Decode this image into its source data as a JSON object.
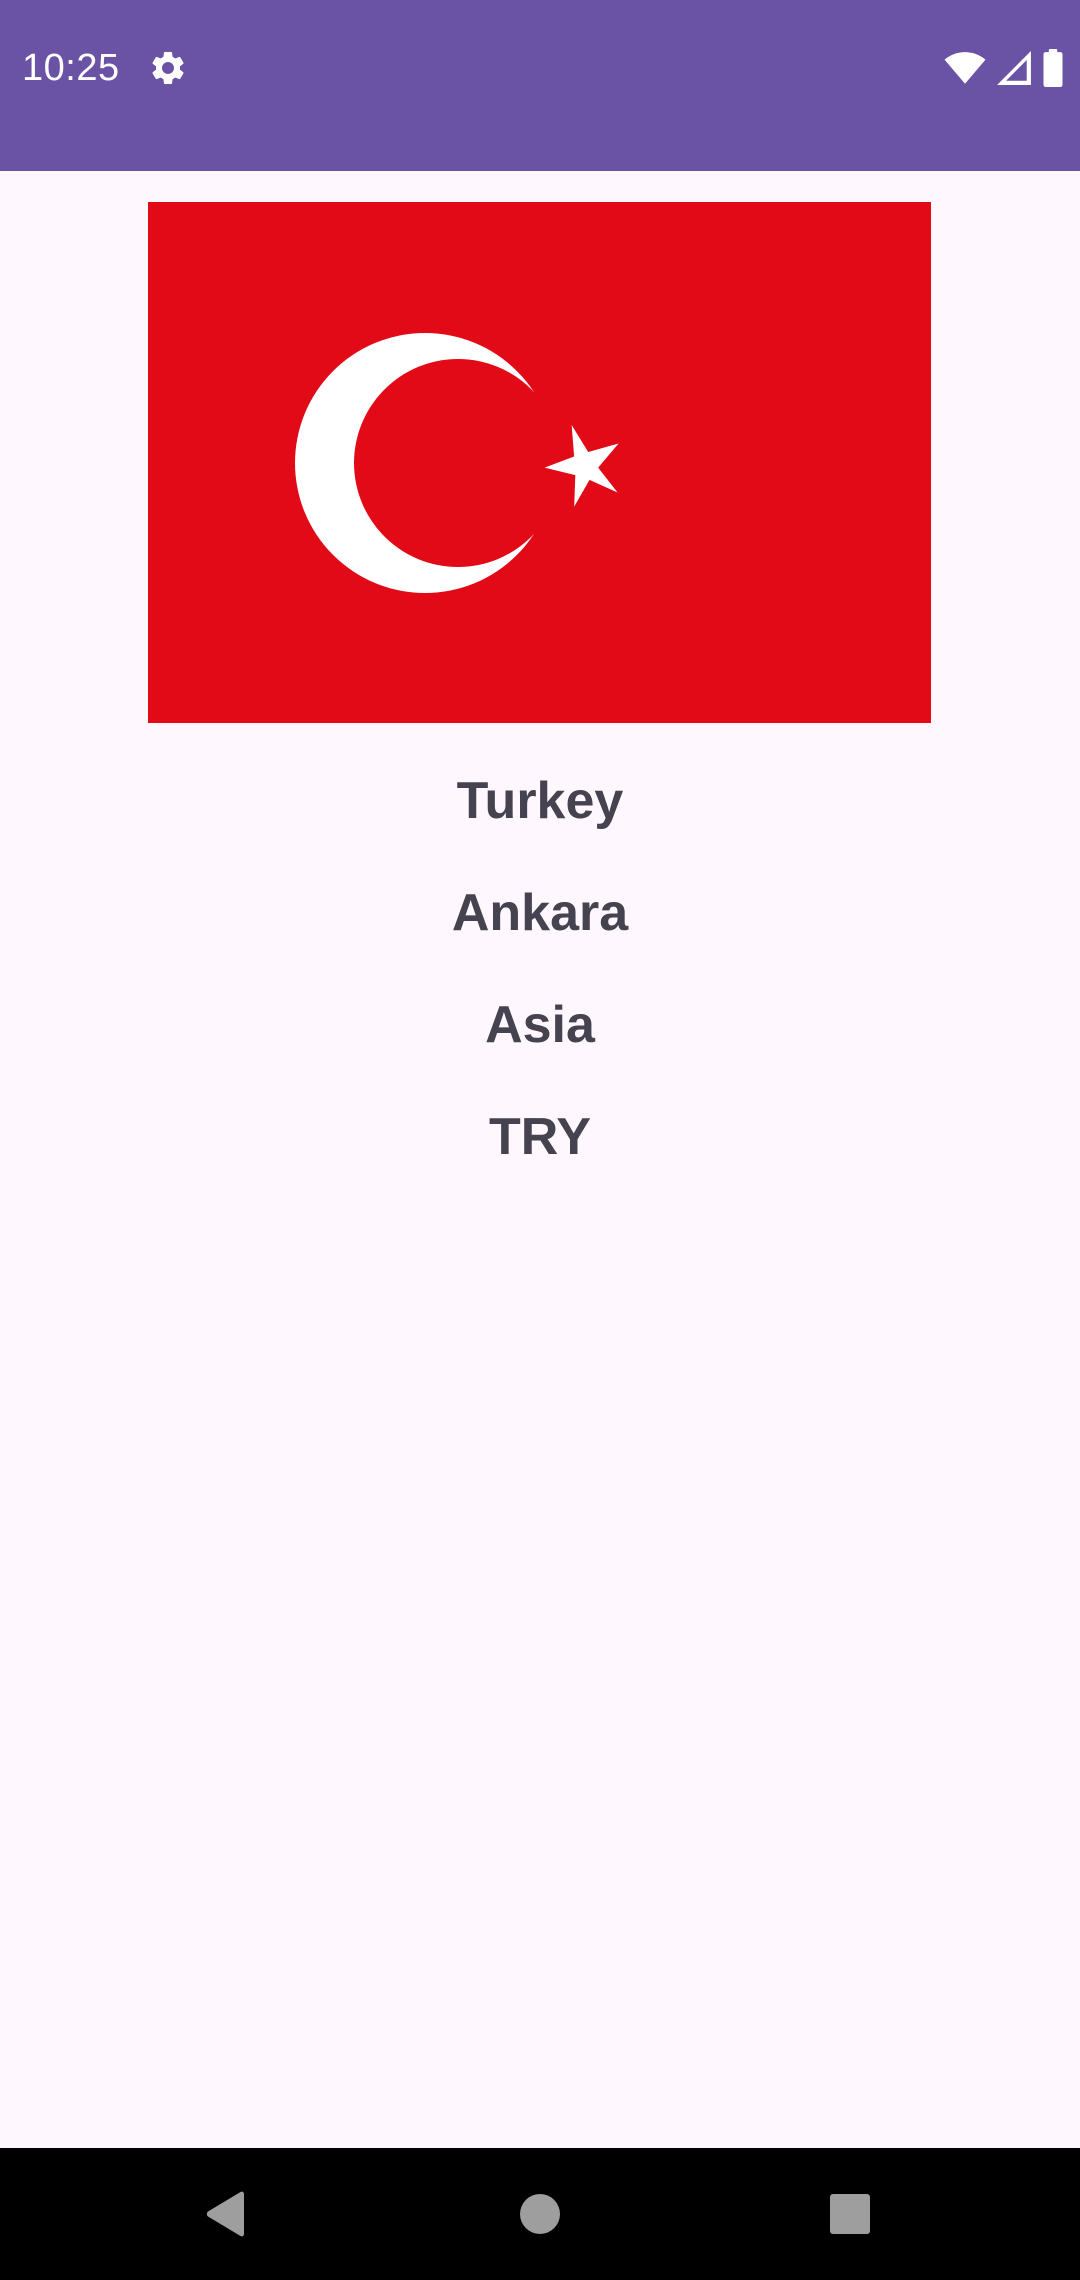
{
  "status_bar": {
    "time": "10:25",
    "icons": [
      "gear-icon",
      "wifi-icon",
      "cell-signal-icon",
      "battery-icon"
    ],
    "background": "#6A52A4"
  },
  "country": {
    "flag": {
      "name": "Turkey flag",
      "colors": {
        "field": "#E30A17",
        "emblem": "#FFFFFF"
      }
    },
    "name": "Turkey",
    "capital": "Ankara",
    "region": "Asia",
    "currency": "TRY"
  },
  "nav_bar": {
    "buttons": [
      "back-icon",
      "home-icon",
      "recents-icon"
    ]
  },
  "colors": {
    "page_background": "#FEF7FE",
    "text": "#45434F"
  }
}
